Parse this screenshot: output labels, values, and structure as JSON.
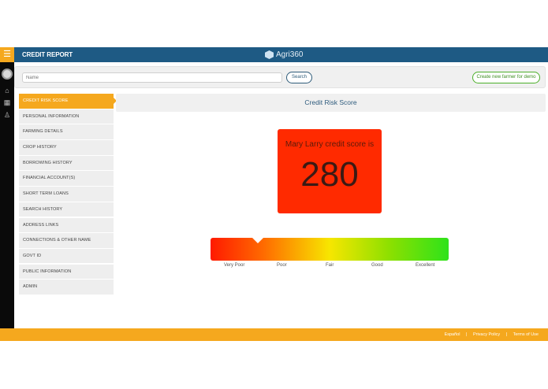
{
  "header": {
    "title": "CREDIT REPORT",
    "brand": "Agri360",
    "menu_icon": "hamburger-icon"
  },
  "rail": {
    "icons": [
      "avatar",
      "home-icon",
      "grid-icon",
      "user-icon"
    ]
  },
  "search": {
    "placeholder": "Name",
    "button": "Search",
    "create_button": "Create new farmer for demo"
  },
  "nav": {
    "items": [
      "CREDIT RISK SCORE",
      "PERSONAL INFORMATION",
      "FARMING DETAILS",
      "CROP HISTORY",
      "BORROWING HISTORY",
      "FINANCIAL ACCOUNT(S)",
      "SHORT TERM LOANS",
      "SEARCH HISTORY",
      "ADDRESS LINKS",
      "CONNECTIONS & OTHER NAME",
      "GOVT ID",
      "PUBLIC INFORMATION",
      "ADMIN"
    ],
    "active": "CREDIT RISK SCORE"
  },
  "main": {
    "title": "Credit Risk Score",
    "score_label": "Mary Larry credit score is",
    "score": "280",
    "scale": [
      "Very Poor",
      "Poor",
      "Fair",
      "Good",
      "Excellent"
    ]
  },
  "footer": {
    "links": [
      "Español",
      "Privacy Policy",
      "Terms of Use"
    ]
  },
  "colors": {
    "accent": "#f5a81e",
    "header": "#1e5a84",
    "score_box": "#ff2a00"
  }
}
